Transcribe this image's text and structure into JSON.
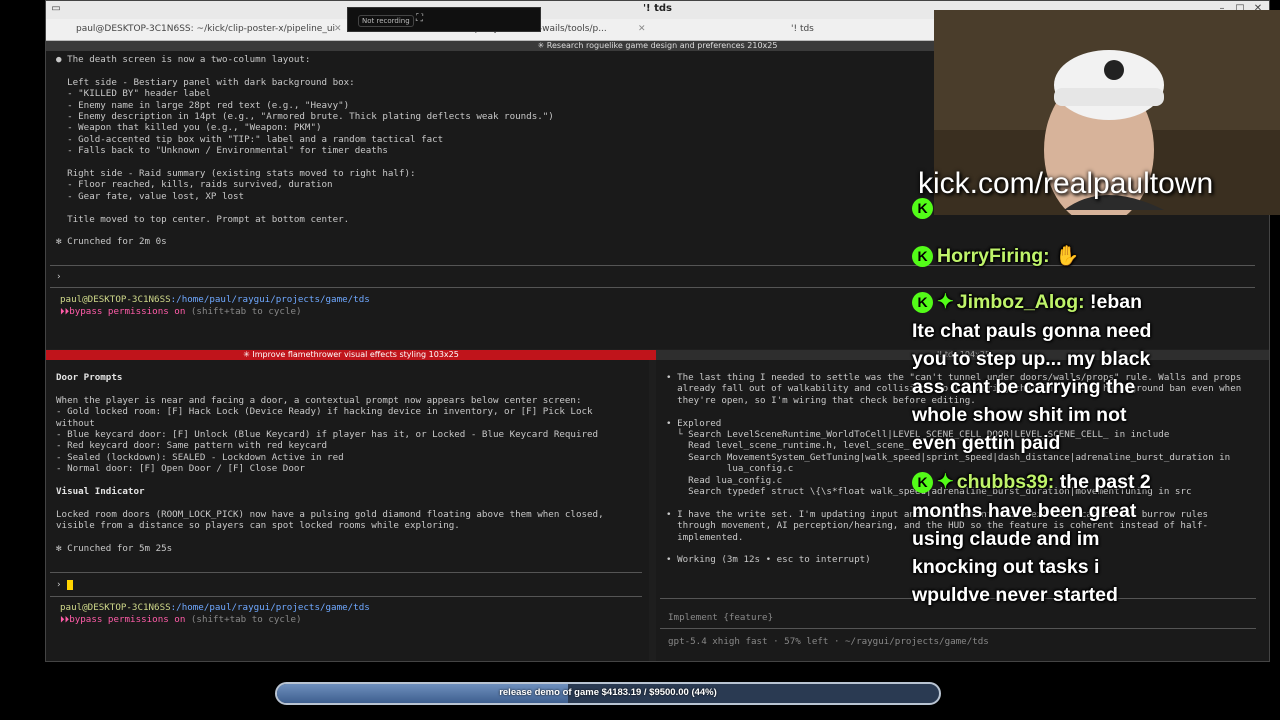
{
  "window": {
    "title": "'! tds",
    "tabs": [
      {
        "label": "paul@DESKTOP-3C1N6SS: ~/kick/clip-poster-x/pipeline_ui"
      },
      {
        "label": "...p...ojects/hoot-wails/tools/p..."
      },
      {
        "label": "'! tds"
      }
    ]
  },
  "recording": {
    "label": "Not recording"
  },
  "pane_top": {
    "strip": "✳ Research roguelike game design and preferences 210x25",
    "lines": [
      "● The death screen is now a two-column layout:",
      "",
      "  Left side - Bestiary panel with dark background box:",
      "  - \"KILLED BY\" header label",
      "  - Enemy name in large 28pt red text (e.g., \"Heavy\")",
      "  - Enemy description in 14pt (e.g., \"Armored brute. Thick plating deflects weak rounds.\")",
      "  - Weapon that killed you (e.g., \"Weapon: PKM\")",
      "  - Gold-accented tip box with \"TIP:\" label and a random tactical fact",
      "  - Falls back to \"Unknown / Environmental\" for timer deaths",
      "",
      "  Right side - Raid summary (existing stats moved to right half):",
      "  - Floor reached, kills, raids survived, duration",
      "  - Gear fate, value lost, XP lost",
      "",
      "  Title moved to top center. Prompt at bottom center.",
      "",
      "✻ Crunched for 2m 0s"
    ],
    "prompt": "›",
    "path_user": "paul@DESKTOP-3C1N6SS",
    "path_dir": ":/home/paul/raygui/projects/game/tds",
    "bypass": "bypass permissions on",
    "bypass_hint": " (shift+tab to cycle)"
  },
  "pane_left": {
    "strip": "✳ Improve flamethrower visual effects styling 103x25",
    "lines": [
      "Door Prompts",
      "",
      "When the player is near and facing a door, a contextual prompt now appears below center screen:",
      "- Gold locked room: [F] Hack Lock (Device Ready) if hacking device in inventory, or [F] Pick Lock",
      "without",
      "- Blue keycard door: [F] Unlock (Blue Keycard) if player has it, or Locked - Blue Keycard Required",
      "- Red keycard door: Same pattern with red keycard",
      "- Sealed (lockdown): SEALED - Lockdown Active in red",
      "- Normal door: [F] Open Door / [F] Close Door",
      "",
      "Visual Indicator",
      "",
      "Locked room doors (ROOM_LOCK_PICK) now have a pulsing gold diamond floating above them when closed,",
      "visible from a distance so players can spot locked rooms while exploring.",
      "",
      "✻ Crunched for 5m 25s"
    ],
    "prompt": "›",
    "path_user": "paul@DESKTOP-3C1N6SS",
    "path_dir": ":/home/paul/raygui/projects/game/tds",
    "bypass": "bypass permissions on",
    "bypass_hint": " (shift+tab to cycle)"
  },
  "pane_right": {
    "strip": "'! tds 104x25",
    "lines": [
      "• The last thing I needed to settle was the \"can't tunnel under doors/walls/props\" rule. Walls and props",
      "  already fall out of walkability and collision, so I'm wiring that in, plus a hard ground ban even when",
      "  they're open, so I'm wiring that check before editing.",
      "",
      "• Explored",
      "  └ Search LevelSceneRuntime_WorldToCell|LEVEL_SCENE_CELL_DOOR|LEVEL_SCENE_CELL_ in include",
      "    Read level_scene_runtime.h, level_scene_",
      "    Search MovementSystem_GetTuning|walk_speed|sprint_speed|dash_distance|adrenaline_burst_duration in",
      "           lua_config.c",
      "    Read lua_config.c",
      "    Search typedef struct \\{\\s*float walk_speed|adrenaline_burst_duration|movementTuning in src",
      "",
      "• I have the write set. I'm updating input and the movement code next so I can thread burrow rules",
      "  through movement, AI perception/hearing, and the HUD so the feature is coherent instead of half-",
      "  implemented.",
      "",
      "• Working (3m 12s • esc to interrupt)"
    ],
    "input_placeholder": "Implement {feature}",
    "footer": "gpt-5.4 xhigh fast · 57% left · ~/raygui/projects/game/tds"
  },
  "overlay": {
    "kick_url": "kick.com/realpaultown",
    "chat": [
      {
        "user": "HorryFiring:",
        "message": "✋",
        "badges": [
          "kick"
        ]
      },
      {
        "user": "Jimboz_Alog:",
        "message": "!eban",
        "badges": [
          "kick",
          "sparkle"
        ]
      },
      {
        "text": "Ite chat pauls gonna need"
      },
      {
        "text": "you to step up... my black"
      },
      {
        "text": "ass cant be carrying the"
      },
      {
        "text": "whole show shit im not"
      },
      {
        "text": "even gettin paid"
      },
      {
        "user": "chubbs39:",
        "message": "the past 2",
        "badges": [
          "kick",
          "sparkle"
        ]
      },
      {
        "text": "months have been great"
      },
      {
        "text": "using claude and im"
      },
      {
        "text": "knocking out tasks i"
      },
      {
        "text": "wpuldve never started"
      }
    ]
  },
  "goal": {
    "label": "release demo of game $4183.19 / $9500.00 (44%)",
    "progress": 0.44
  },
  "colors": {
    "kick_green": "#53fc18",
    "pane_red": "#c0141b",
    "path_blue": "#6fa8ff",
    "bypass_pink": "#ff5ca8"
  }
}
